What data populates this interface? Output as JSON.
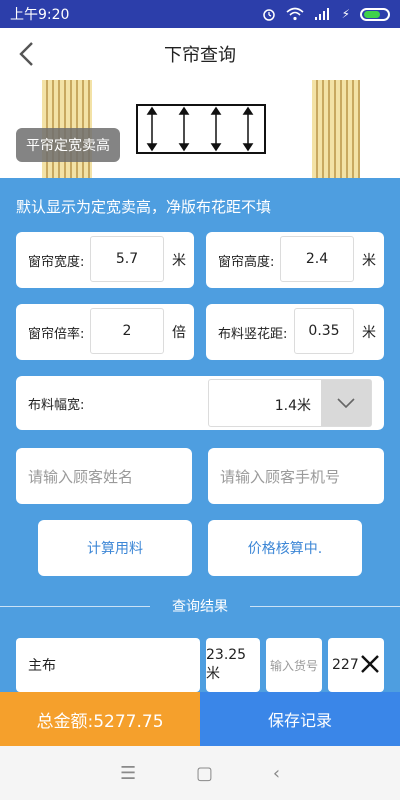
{
  "status_bar": {
    "time": "上午9:20",
    "icons": [
      "alarm-icon",
      "wifi-icon",
      "signal-icon",
      "charging-icon",
      "battery-icon"
    ]
  },
  "nav": {
    "title": "下帘查询",
    "back_icon": "chevron-left-icon"
  },
  "banner": {
    "tag_label": "平帘定宽卖高"
  },
  "main": {
    "hint": "默认显示为定宽卖高，净版布花距不填",
    "width_field": {
      "label": "窗帘宽度:",
      "value": "5.7",
      "unit": "米"
    },
    "height_field": {
      "label": "窗帘高度:",
      "value": "2.4",
      "unit": "米"
    },
    "multiple_field": {
      "label": "窗帘倍率:",
      "value": "2",
      "unit": "倍"
    },
    "pattern_field": {
      "label": "布料竖花距:",
      "value": "0.35",
      "unit": "米"
    },
    "fabric_width": {
      "label": "布料幅宽:",
      "selected": "1.4米"
    },
    "customer_name_placeholder": "请输入顾客姓名",
    "customer_phone_placeholder": "请输入顾客手机号",
    "calc_button": "计算用料",
    "price_button": "价格核算中.",
    "results_title": "查询结果",
    "result_row": {
      "name": "主布",
      "amount": "23.25米",
      "goods_placeholder": "输入货号",
      "price": "227"
    }
  },
  "bottom": {
    "total": "总金额:5277.75",
    "save": "保存记录"
  },
  "system_nav": {
    "menu": "☰",
    "home": "▢",
    "back": "‹"
  },
  "colors": {
    "primary_blue": "#4e9ee0",
    "orange": "#f5a02c",
    "save_blue": "#3a86e8",
    "status_bar": "#2c3eaa"
  }
}
